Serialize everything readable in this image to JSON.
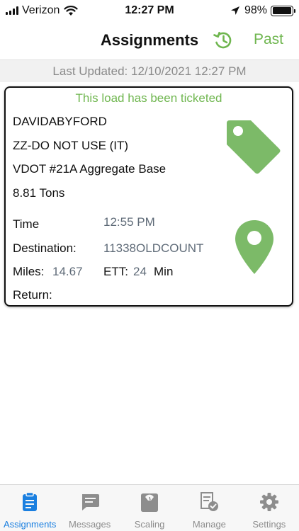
{
  "status_bar": {
    "carrier": "Verizon",
    "time": "12:27 PM",
    "battery_percent": "98%",
    "battery_level": 0.98
  },
  "nav": {
    "title": "Assignments",
    "history_icon": "history-clock-icon",
    "past_label": "Past"
  },
  "updated": {
    "text": "Last Updated:  12/10/2021 12:27 PM"
  },
  "card": {
    "ticket_message": "This load has been ticketed",
    "driver": "DAVIDABYFORD",
    "customer": "ZZ-DO NOT USE (IT)",
    "product": "VDOT #21A Aggregate Base",
    "quantity": "8.81  Tons",
    "time_label": "Time",
    "time_value": "12:55 PM",
    "destination_label": "Destination:",
    "destination_value": "11338OLDCOUNT",
    "miles_label": "Miles:",
    "miles_value": "14.67",
    "ett_label": "ETT:",
    "ett_value": "24",
    "ett_unit": "Min",
    "return_label": "Return:",
    "tag_icon": "price-tag-icon",
    "pin_icon": "map-pin-icon"
  },
  "tabs": [
    {
      "label": "Assignments",
      "icon": "clipboard-icon",
      "active": true
    },
    {
      "label": "Messages",
      "icon": "chat-bubble-icon",
      "active": false
    },
    {
      "label": "Scaling",
      "icon": "scale-icon",
      "active": false
    },
    {
      "label": "Manage",
      "icon": "document-check-icon",
      "active": false
    },
    {
      "label": "Settings",
      "icon": "gear-icon",
      "active": false
    }
  ],
  "colors": {
    "accent_green": "#6fb64f",
    "icon_green": "#7cba68",
    "active_tab_blue": "#1a7fe0",
    "inactive_tab_gray": "#8d8d8d"
  }
}
